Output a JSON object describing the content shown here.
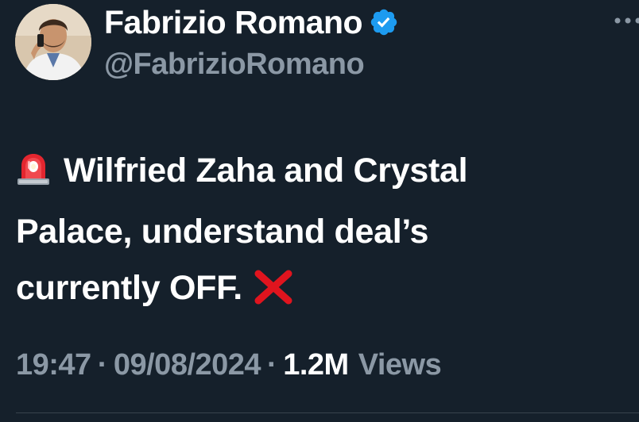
{
  "author": {
    "display_name": "Fabrizio Romano",
    "handle": "@FabrizioRomano",
    "verified": true,
    "avatar_icon": "profile-photo-icon",
    "verified_color": "#1d9bf0"
  },
  "tweet": {
    "lines": [
      "Wilfried Zaha and Crystal",
      "Palace, understand deal’s",
      "currently OFF."
    ],
    "leading_emoji": "police-siren-icon",
    "trailing_emoji": "red-cross-mark-icon"
  },
  "meta": {
    "time": "19:47",
    "separator": "·",
    "date": "09/08/2024",
    "views_count": "1.2M",
    "views_label": "Views"
  },
  "colors": {
    "background": "#15202b",
    "primary_text": "#ffffff",
    "secondary_text": "#8b98a5",
    "divider": "#38444d"
  }
}
